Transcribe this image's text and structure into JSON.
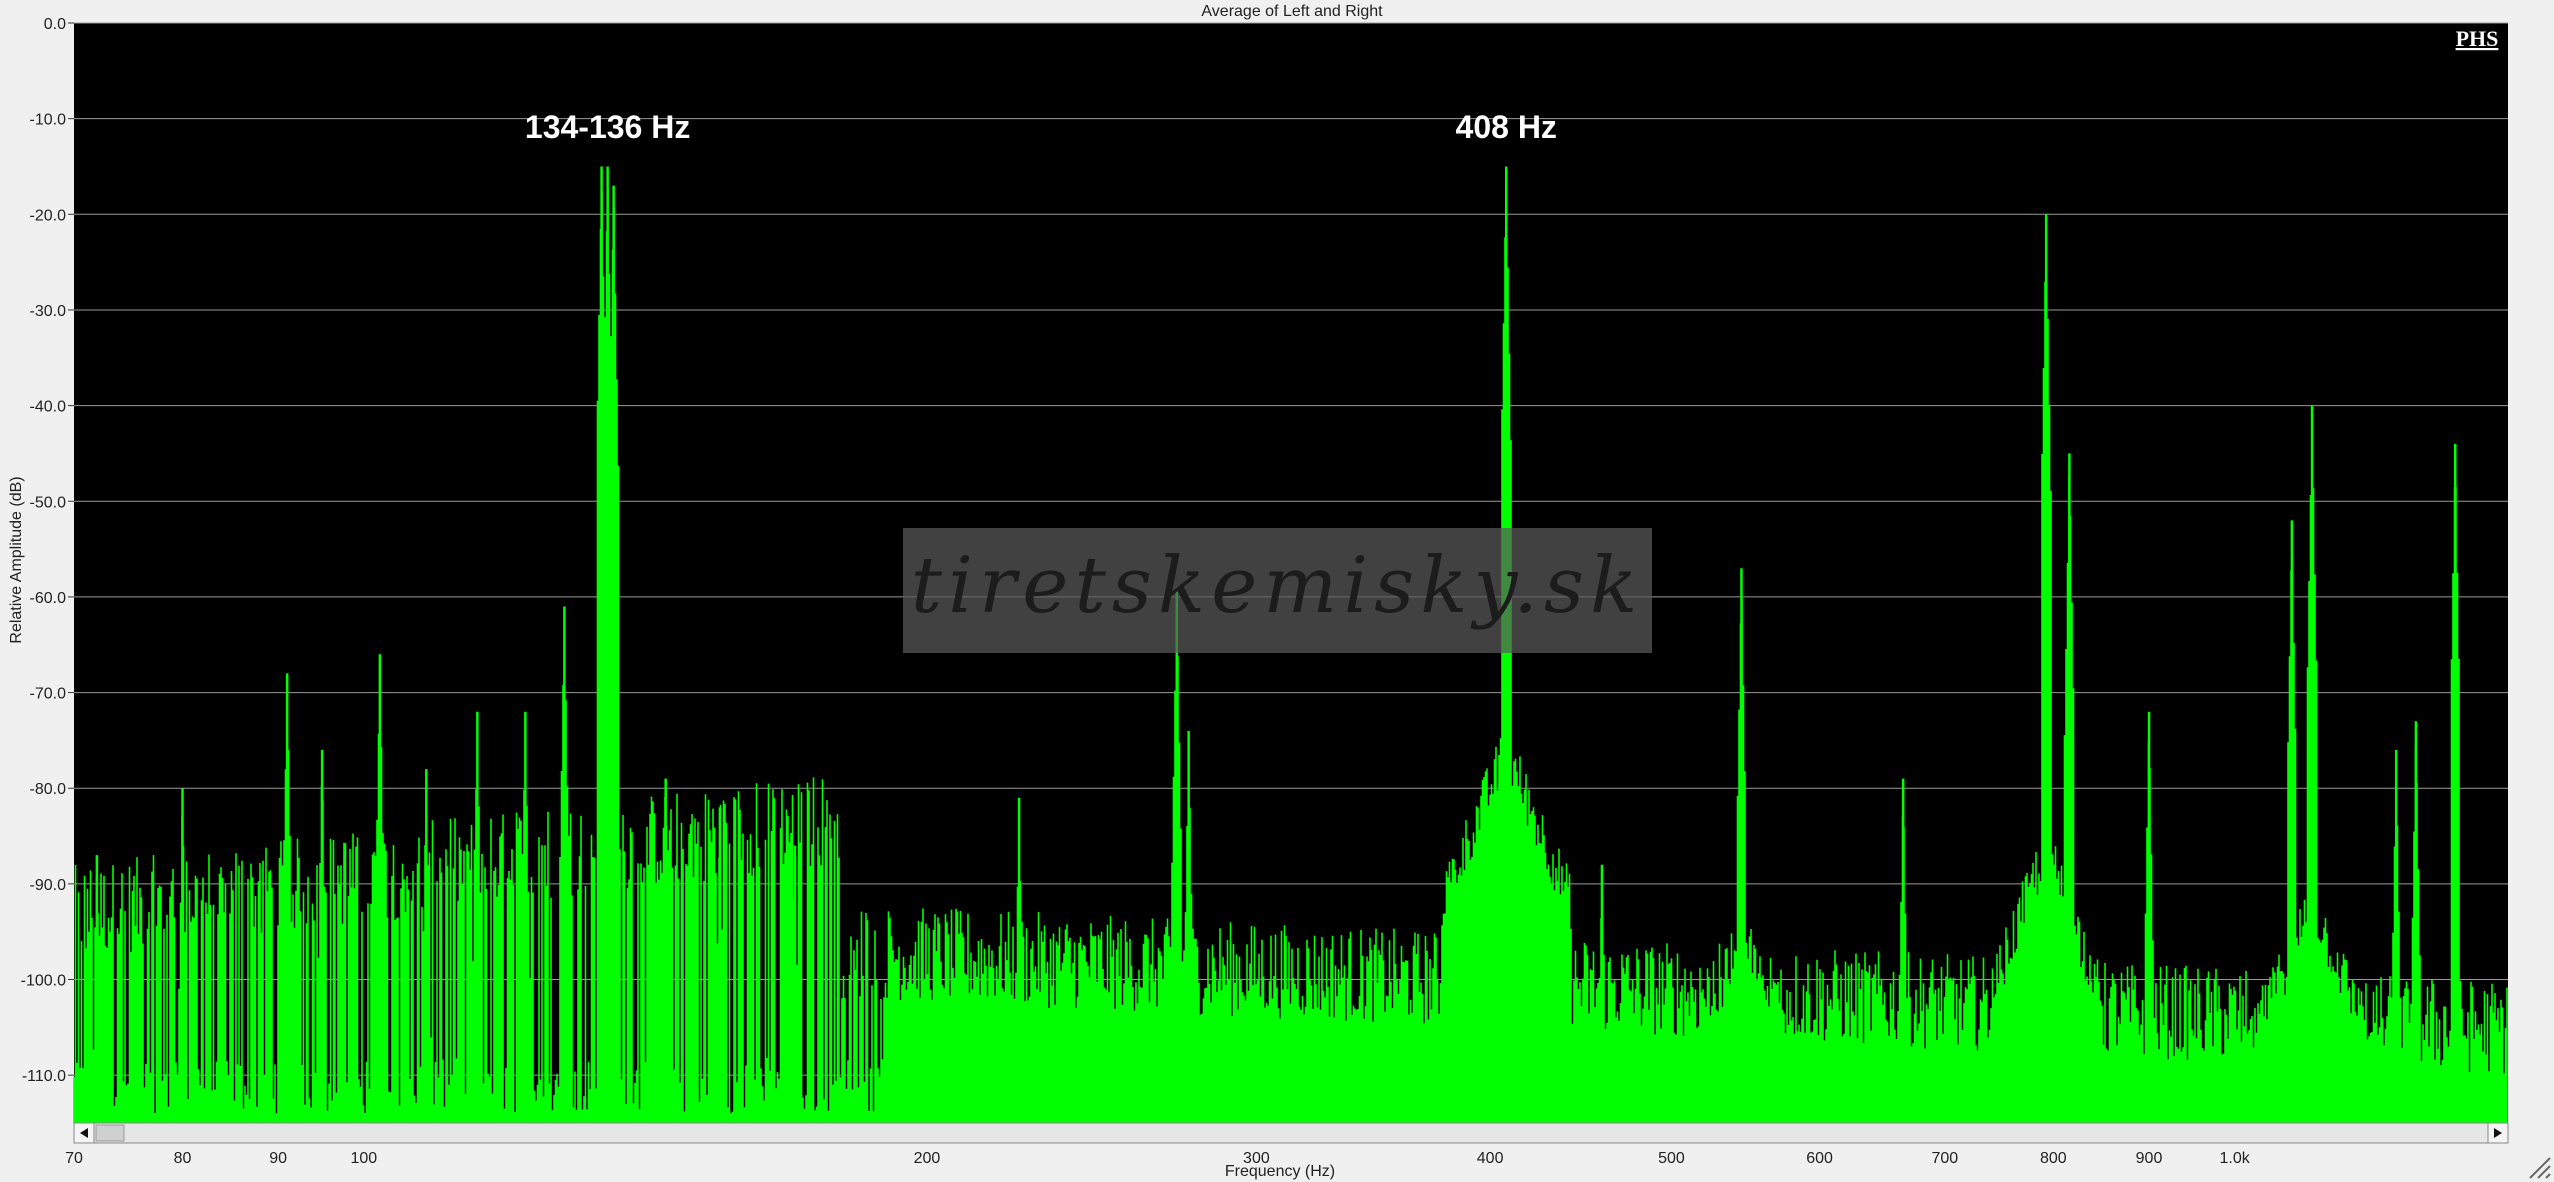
{
  "chart_data": {
    "type": "area",
    "title": "Average of Left and Right",
    "xlabel": "Frequency (Hz)",
    "ylabel": "Relative Amplitude (dB)",
    "x_scale": "log",
    "xlim": [
      70,
      1400
    ],
    "ylim": [
      -115,
      0
    ],
    "y_ticks": [
      "0.0",
      "-10.0",
      "-20.0",
      "-30.0",
      "-40.0",
      "-50.0",
      "-60.0",
      "-70.0",
      "-80.0",
      "-90.0",
      "-100.0",
      "-110.0"
    ],
    "x_ticks": [
      {
        "v": 70,
        "label": "70"
      },
      {
        "v": 80,
        "label": "80"
      },
      {
        "v": 90,
        "label": "90"
      },
      {
        "v": 100,
        "label": "100"
      },
      {
        "v": 200,
        "label": "200"
      },
      {
        "v": 300,
        "label": "300"
      },
      {
        "v": 400,
        "label": "400"
      },
      {
        "v": 500,
        "label": "500"
      },
      {
        "v": 600,
        "label": "600"
      },
      {
        "v": 700,
        "label": "700"
      },
      {
        "v": 800,
        "label": "800"
      },
      {
        "v": 900,
        "label": "900"
      },
      {
        "v": 1000,
        "label": "1.0k"
      }
    ],
    "grid": "horizontal",
    "series_color": "#00ff00",
    "background_color": "#000000",
    "peaks": [
      {
        "x": 72,
        "y": -87
      },
      {
        "x": 80,
        "y": -80
      },
      {
        "x": 91,
        "y": -68
      },
      {
        "x": 95,
        "y": -76
      },
      {
        "x": 102,
        "y": -66
      },
      {
        "x": 108,
        "y": -78
      },
      {
        "x": 115,
        "y": -72
      },
      {
        "x": 122,
        "y": -72
      },
      {
        "x": 128,
        "y": -61
      },
      {
        "x": 134,
        "y": -15
      },
      {
        "x": 135,
        "y": -15
      },
      {
        "x": 136,
        "y": -17
      },
      {
        "x": 145,
        "y": -79
      },
      {
        "x": 155,
        "y": -82
      },
      {
        "x": 170,
        "y": -86
      },
      {
        "x": 224,
        "y": -81
      },
      {
        "x": 272,
        "y": -59
      },
      {
        "x": 276,
        "y": -74
      },
      {
        "x": 408,
        "y": -15
      },
      {
        "x": 459,
        "y": -88
      },
      {
        "x": 545,
        "y": -57
      },
      {
        "x": 665,
        "y": -79
      },
      {
        "x": 793,
        "y": -20
      },
      {
        "x": 816,
        "y": -45
      },
      {
        "x": 900,
        "y": -72
      },
      {
        "x": 1073,
        "y": -52
      },
      {
        "x": 1100,
        "y": -40
      },
      {
        "x": 1220,
        "y": -76
      },
      {
        "x": 1250,
        "y": -73
      },
      {
        "x": 1312,
        "y": -44
      }
    ],
    "annotations": [
      {
        "text": "134-136 Hz",
        "x": 135,
        "y": -12
      },
      {
        "text": "408 Hz",
        "x": 408,
        "y": -12
      }
    ],
    "brand": "PHS",
    "watermark": "tiretskemisky.sk"
  }
}
